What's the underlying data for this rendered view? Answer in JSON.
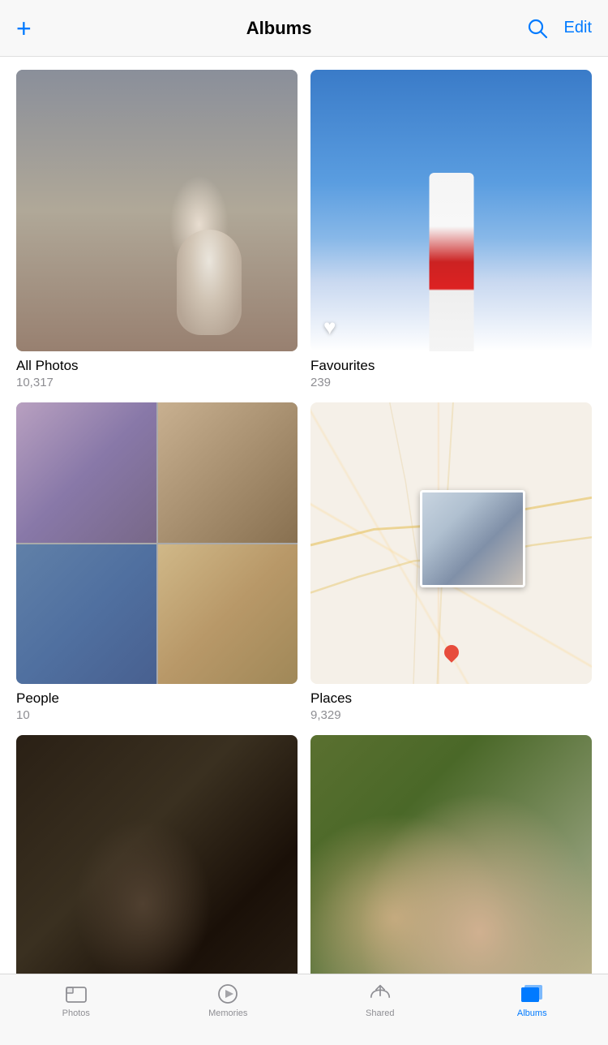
{
  "header": {
    "title": "Albums",
    "add_label": "+",
    "edit_label": "Edit"
  },
  "albums": [
    {
      "name": "All Photos",
      "count": "10,317",
      "type": "all-photos"
    },
    {
      "name": "Favourites",
      "count": "239",
      "type": "favourites"
    },
    {
      "name": "People",
      "count": "10",
      "type": "people"
    },
    {
      "name": "Places",
      "count": "9,329",
      "type": "places"
    },
    {
      "name": "",
      "count": "",
      "type": "dark"
    },
    {
      "name": "",
      "count": "",
      "type": "group"
    }
  ],
  "tabs": [
    {
      "label": "Photos",
      "icon": "photos-icon",
      "active": false
    },
    {
      "label": "Memories",
      "icon": "memories-icon",
      "active": false
    },
    {
      "label": "Shared",
      "icon": "shared-icon",
      "active": false
    },
    {
      "label": "Albums",
      "icon": "albums-icon",
      "active": true
    }
  ]
}
